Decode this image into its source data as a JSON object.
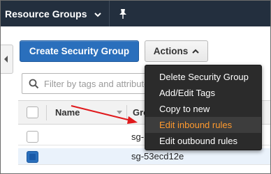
{
  "topbar": {
    "resource_groups_label": "Resource Groups",
    "caret_icon": "chevron-down-icon",
    "pin_icon": "pin-icon"
  },
  "toolbar": {
    "create_label": "Create Security Group",
    "actions_label": "Actions"
  },
  "filter": {
    "placeholder": "Filter by tags and attributes"
  },
  "table": {
    "columns": [
      "Name",
      "Group ID"
    ],
    "rows": [
      {
        "group_id": "sg-",
        "checked": false
      },
      {
        "group_id": "sg-53ecd12e",
        "checked": true
      }
    ]
  },
  "actions_menu": {
    "items": [
      "Delete Security Group",
      "Add/Edit Tags",
      "Copy to new",
      "Edit inbound rules",
      "Edit outbound rules"
    ],
    "highlighted_index": 3,
    "highlight_color": "#ff9a2e"
  },
  "colors": {
    "nav_bg": "#232f3e",
    "primary": "#2a6fbc",
    "menu_bg": "#2b2b2b",
    "annotation_arrow": "#e0191c"
  }
}
